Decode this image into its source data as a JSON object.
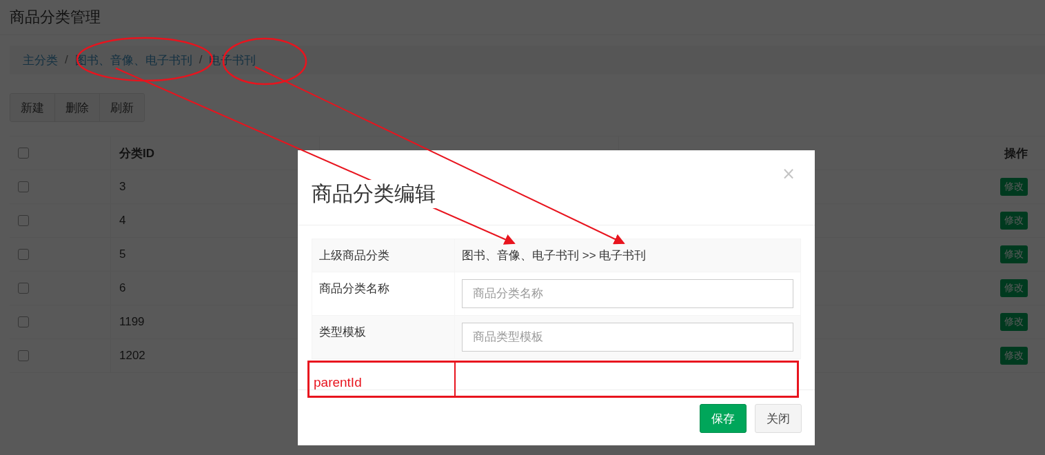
{
  "page_title": "商品分类管理",
  "breadcrumb": [
    {
      "label": "主分类"
    },
    {
      "separator": "/",
      "label": "图书、音像、电子书刊"
    },
    {
      "separator": "/",
      "label": "电子书刊"
    }
  ],
  "toolbar": [
    "新建",
    "删除",
    "刷新"
  ],
  "table": {
    "select_all": {
      "checked": false
    },
    "columns": {
      "id": "分类ID",
      "action": "操作"
    },
    "rows": [
      {
        "checked": false,
        "id": "3",
        "action": "修改"
      },
      {
        "checked": false,
        "id": "4",
        "action": "修改"
      },
      {
        "checked": false,
        "id": "5",
        "action": "修改"
      },
      {
        "checked": false,
        "id": "6",
        "action": "修改"
      },
      {
        "checked": false,
        "id": "1199",
        "action": "修改"
      },
      {
        "checked": false,
        "id": "1202",
        "action": "修改"
      }
    ]
  },
  "modal": {
    "title": "商品分类编辑",
    "close": "×",
    "rows": [
      {
        "kind": "text",
        "label": "上级商品分类",
        "value": "图书、音像、电子书刊 >> 电子书刊"
      },
      {
        "kind": "input",
        "label": "商品分类名称",
        "placeholder": "商品分类名称"
      },
      {
        "kind": "input",
        "label": "类型模板",
        "placeholder": "商品类型模板"
      }
    ],
    "buttons": [
      {
        "kind": "primary",
        "label": "保存"
      },
      {
        "kind": "default",
        "label": "关闭"
      }
    ]
  },
  "annotation": {
    "label": "parentId"
  }
}
